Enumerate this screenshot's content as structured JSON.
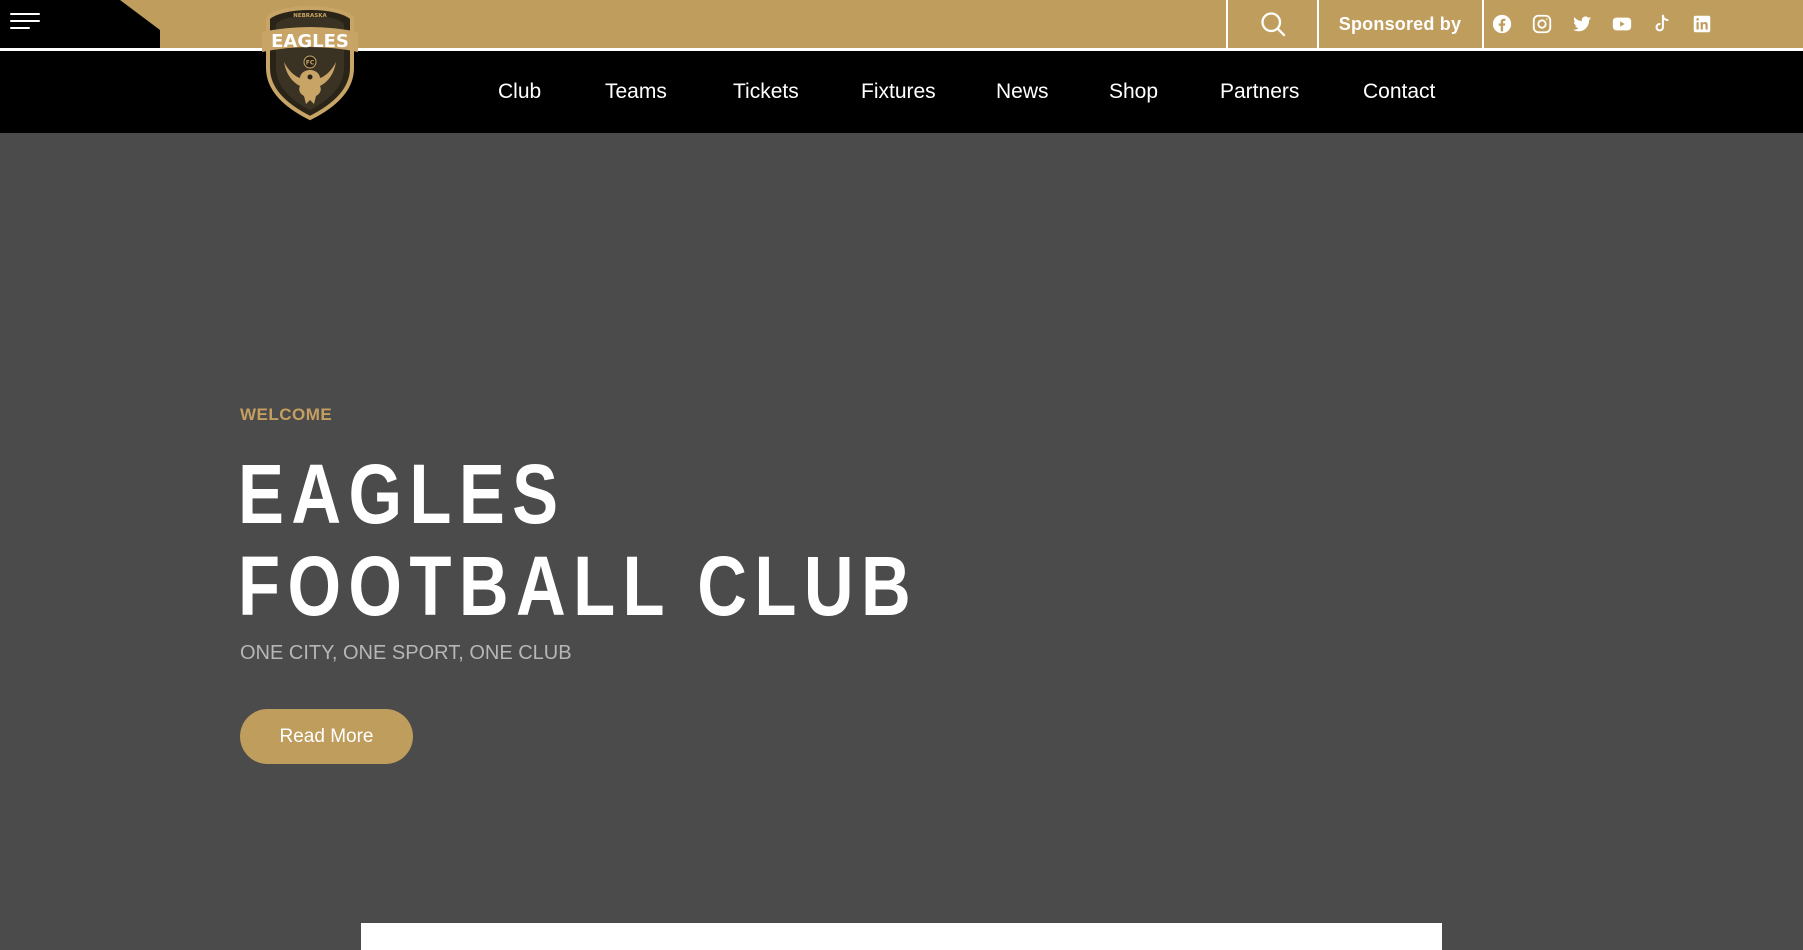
{
  "topbar": {
    "sponsored_label": "Sponsored by",
    "social_icons": [
      "facebook-icon",
      "instagram-icon",
      "twitter-icon",
      "youtube-icon",
      "tiktok-icon",
      "linkedin-icon"
    ]
  },
  "logo": {
    "name": "EAGLES",
    "small_top": "NEBRASKA",
    "badge": "FC"
  },
  "nav": {
    "items": [
      "Club",
      "Teams",
      "Tickets",
      "Fixtures",
      "News",
      "Shop",
      "Partners",
      "Contact"
    ]
  },
  "hero": {
    "eyebrow": "WELCOME",
    "title_line1": "EAGLES",
    "title_line2": "FOOTBALL CLUB",
    "subtitle": "ONE CITY, ONE SPORT, ONE CLUB",
    "cta_label": "Read More"
  },
  "colors": {
    "gold": "#bf9d5d",
    "hero_bg": "#4b4b4b",
    "nav_bg": "#000000"
  }
}
